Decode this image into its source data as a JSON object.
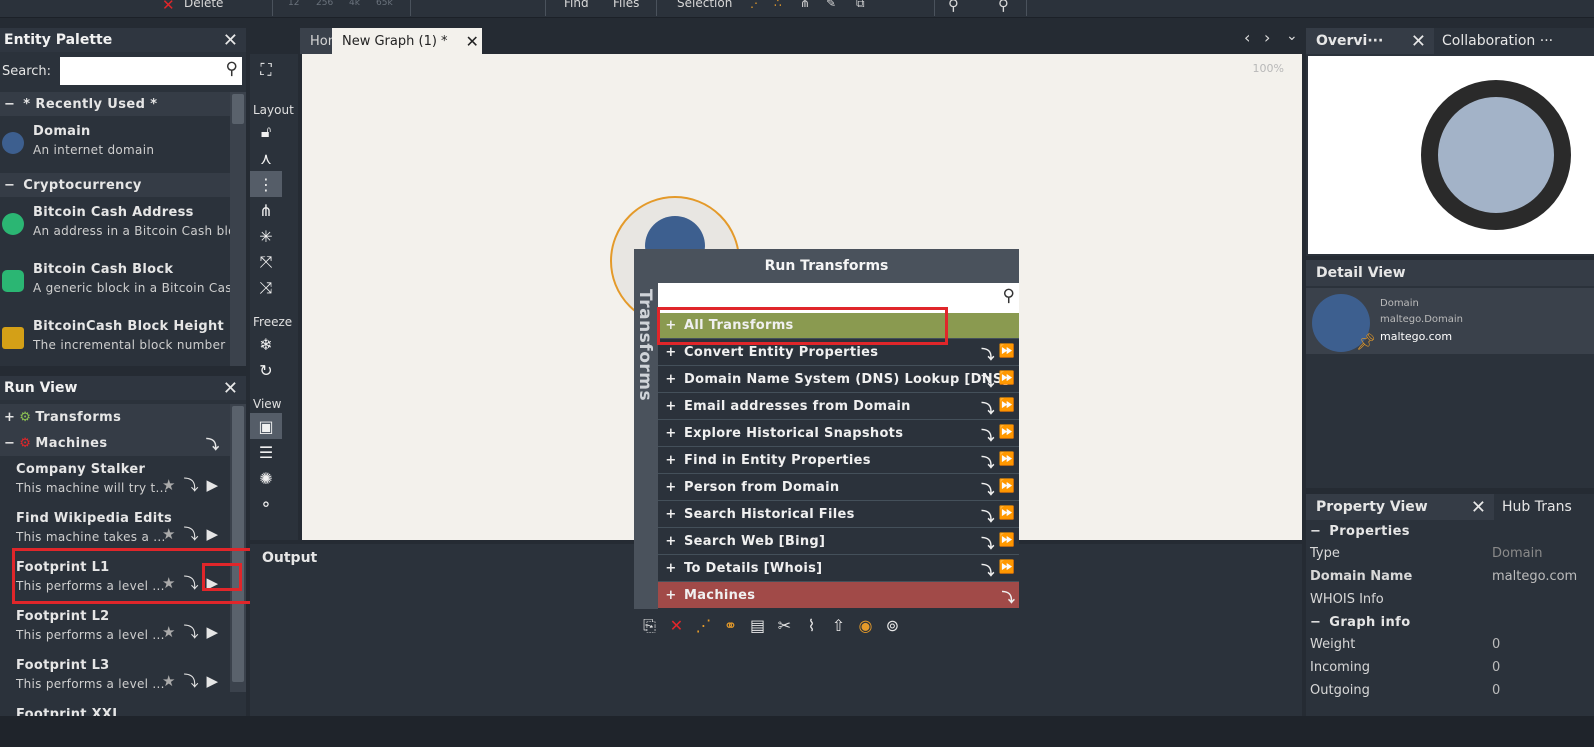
{
  "toolbar": {
    "delete_label": "Delete",
    "faded_numbers": [
      "12",
      "256",
      "4k",
      "65k"
    ],
    "find_label": "Find",
    "files_label": "Files",
    "selection_label": "Selection"
  },
  "entity_palette": {
    "title": "Entity Palette",
    "search_label": "Search:",
    "search_value": "",
    "groups": [
      {
        "label": "* Recently Used *",
        "items": [
          {
            "name": "Domain",
            "desc": "An internet domain",
            "color": "#3d5f8f"
          }
        ]
      },
      {
        "label": "Cryptocurrency",
        "items": [
          {
            "name": "Bitcoin Cash Address",
            "desc": "An address in a Bitcoin Cash blockchain",
            "color": "#2bb673"
          },
          {
            "name": "Bitcoin Cash Block",
            "desc": "A generic block in a Bitcoin Cash blockchain",
            "color": "#2bb673"
          },
          {
            "name": "BitcoinCash Block Height",
            "desc": "The incremental block number in a blockchain",
            "color": "#d4a017"
          }
        ]
      }
    ]
  },
  "run_view": {
    "title": "Run View",
    "transforms_label": "Transforms",
    "machines_label": "Machines",
    "machines": [
      {
        "name": "Company Stalker",
        "desc": "This machine will try t..."
      },
      {
        "name": "Find Wikipedia Edits",
        "desc": "This machine takes a ..."
      },
      {
        "name": "Footprint L1",
        "desc": "This performs a level ..."
      },
      {
        "name": "Footprint L2",
        "desc": "This performs a level ..."
      },
      {
        "name": "Footprint L3",
        "desc": "This performs a level ..."
      },
      {
        "name": "Footprint XXL",
        "desc": ""
      }
    ]
  },
  "tools": {
    "layout_label": "Layout",
    "freeze_label": "Freeze",
    "view_label": "View"
  },
  "tabs": {
    "home": "Home",
    "active": "New Graph (1) *"
  },
  "graph": {
    "zoom": "100%"
  },
  "output": {
    "title": "Output"
  },
  "run_transforms": {
    "title": "Run Transforms",
    "side_label": "Transforms",
    "search_value": "",
    "all_label": "All Transforms",
    "items": [
      "Convert Entity Properties",
      "Domain Name System (DNS) Lookup [DNS]",
      "Email addresses from Domain",
      "Explore Historical Snapshots",
      "Find in Entity Properties",
      "Person from Domain",
      "Search Historical Files",
      "Search Web [Bing]",
      "To Details [Whois]"
    ],
    "machines_label": "Machines"
  },
  "overview": {
    "tab_overview": "Overvi···",
    "tab_collab": "Collaboration ···"
  },
  "detail_view": {
    "title": "Detail View",
    "type": "Domain",
    "type_id": "maltego.Domain",
    "value": "maltego.com"
  },
  "property_view": {
    "title": "Property View",
    "tab_hub": "Hub Trans",
    "properties_label": "Properties",
    "props": [
      {
        "k": "Type",
        "v": "Domain"
      },
      {
        "k": "Domain Name",
        "v": "maltego.com"
      },
      {
        "k": "WHOIS Info",
        "v": ""
      }
    ],
    "graph_info_label": "Graph info",
    "graph_info": [
      {
        "k": "Weight",
        "v": "0"
      },
      {
        "k": "Incoming",
        "v": "0"
      },
      {
        "k": "Outgoing",
        "v": "0"
      }
    ]
  },
  "colors": {
    "accent_orange": "#e49a2a",
    "highlight_green": "#8a9a50",
    "machines_red": "#a14a48",
    "annotation_red": "#e0262a"
  }
}
